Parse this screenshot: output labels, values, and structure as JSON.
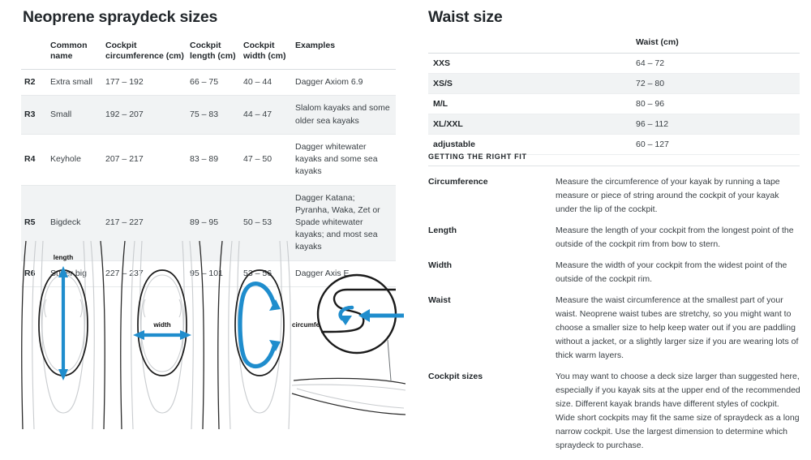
{
  "colors": {
    "accent_blue": "#1f8dcd",
    "heading": "#22272b",
    "body_text": "#3a4045",
    "row_stripe": "#f1f3f4",
    "rule": "#d8dcdf",
    "outline_dark": "#1a1a1a",
    "outline_light": "#c9cccf"
  },
  "left": {
    "title": "Neoprene spraydeck sizes",
    "table": {
      "headers": {
        "code": "",
        "common_name": "Common name",
        "circumference": "Cockpit circumference (cm)",
        "length": "Cockpit length (cm)",
        "width": "Cockpit width (cm)",
        "examples": "Examples"
      },
      "rows": [
        {
          "code": "R2",
          "common_name": "Extra small",
          "circumference": "177 – 192",
          "length": "66 – 75",
          "width": "40 – 44",
          "examples": "Dagger Axiom 6.9"
        },
        {
          "code": "R3",
          "common_name": "Small",
          "circumference": "192 – 207",
          "length": "75 – 83",
          "width": "44 – 47",
          "examples": "Slalom kayaks and some older sea kayaks"
        },
        {
          "code": "R4",
          "common_name": "Keyhole",
          "circumference": "207 – 217",
          "length": "83 – 89",
          "width": "47 – 50",
          "examples": "Dagger whitewater kayaks and some sea kayaks"
        },
        {
          "code": "R5",
          "common_name": "Bigdeck",
          "circumference": "217 – 227",
          "length": "89 – 95",
          "width": "50 – 53",
          "examples": "Dagger Katana; Pyranha, Waka, Zet or Spade whitewater kayaks; and most sea kayaks"
        },
        {
          "code": "R6",
          "common_name": "Super big",
          "circumference": "227 – 237",
          "length": "95 – 101",
          "width": "53 – 56",
          "examples": "Dagger Axis E"
        }
      ]
    },
    "diagrams": {
      "length_label": "length",
      "width_label": "width",
      "circumference_label": "circumference"
    }
  },
  "right": {
    "title": "Waist size",
    "waist_table": {
      "headers": {
        "size": "",
        "waist": "Waist (cm)"
      },
      "rows": [
        {
          "size": "XXS",
          "waist": "64 – 72"
        },
        {
          "size": "XS/S",
          "waist": "72 – 80"
        },
        {
          "size": "M/L",
          "waist": "80 – 96"
        },
        {
          "size": "XL/XXL",
          "waist": "96 – 112"
        },
        {
          "size": "adjustable",
          "waist": "60 – 127"
        }
      ]
    },
    "fit": {
      "heading": "GETTING THE RIGHT FIT",
      "items": [
        {
          "label": "Circumference",
          "text": "Measure the circumference of your kayak by running a tape measure or piece of string around the cockpit of your kayak under the lip of the cockpit."
        },
        {
          "label": "Length",
          "text": "Measure the length of your cockpit from the longest point of the outside of the cockpit rim from bow to stern."
        },
        {
          "label": "Width",
          "text": "Measure the width of your cockpit from the widest point of the outside of the cockpit rim."
        },
        {
          "label": "Waist",
          "text": "Measure the waist circumference at the smallest part of your waist. Neoprene waist tubes are stretchy, so you might want to choose a smaller size to help keep water out if you are paddling without a jacket, or a slightly larger size if you are wearing lots of thick warm layers."
        },
        {
          "label": "Cockpit sizes",
          "text": "You may want to choose a deck size larger than suggested here, especially if you kayak sits at the upper end of the recommended size. Different kayak brands have different styles of cockpit. Wide short cockpits may fit the same size of spraydeck as a long narrow cockpit. Use the largest dimension to determine which spraydeck to purchase."
        }
      ]
    }
  }
}
